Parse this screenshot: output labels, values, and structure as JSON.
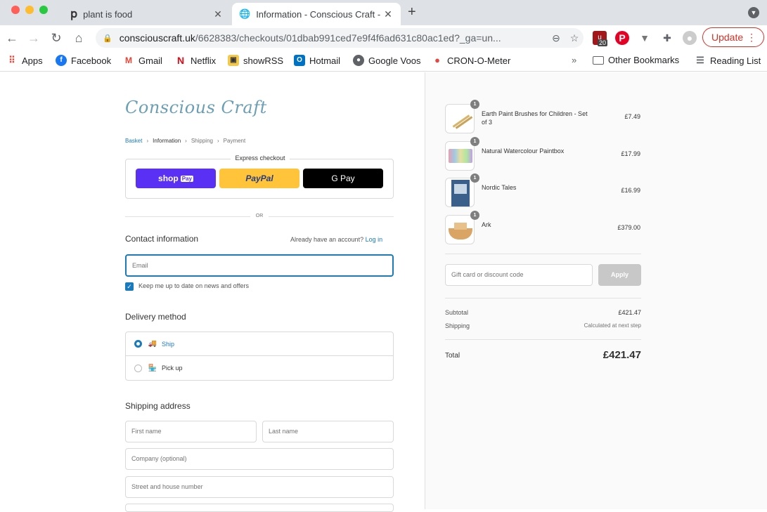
{
  "browser": {
    "tabs": [
      {
        "title": "plant is food",
        "icon": "pinterest-p-icon"
      },
      {
        "title": "Information - Conscious Craft -",
        "icon": "globe-icon"
      }
    ],
    "url_host": "consciouscraft.uk",
    "url_path": "/6628383/checkouts/01dbab991ced7e9f4f6ad631c80ac1ed?_ga=un...",
    "extension_badge": "20",
    "update_label": "Update",
    "bookmarks": [
      "Apps",
      "Facebook",
      "Gmail",
      "Netflix",
      "showRSS",
      "Hotmail",
      "Google Voos",
      "CRON-O-Meter"
    ],
    "more": "»",
    "other_bookmarks": "Other Bookmarks",
    "reading_list": "Reading List"
  },
  "checkout": {
    "logo": "Conscious Craft",
    "breadcrumb": [
      "Basket",
      "Information",
      "Shipping",
      "Payment"
    ],
    "express_title": "Express checkout",
    "shop_pay": "shop",
    "shop_pay_tag": "Pay",
    "paypal": "PayPal",
    "gpay": "G Pay",
    "or": "OR",
    "contact_title": "Contact information",
    "account_hint": "Already have an account?",
    "login_link": "Log in",
    "email_placeholder": "Email",
    "newsletter_label": "Keep me up to date on news and offers",
    "delivery_title": "Delivery method",
    "delivery_options": [
      {
        "label": "Ship",
        "selected": true
      },
      {
        "label": "Pick up",
        "selected": false
      }
    ],
    "shipping_title": "Shipping address",
    "first_name": "First name",
    "last_name": "Last name",
    "company": "Company (optional)",
    "street": "Street and house number"
  },
  "summary": {
    "items": [
      {
        "name": "Earth Paint Brushes for Children - Set of 3",
        "qty": "1",
        "price": "£7.49"
      },
      {
        "name": "Natural Watercolour Paintbox",
        "qty": "1",
        "price": "£17.99"
      },
      {
        "name": "Nordic Tales",
        "qty": "1",
        "price": "£16.99"
      },
      {
        "name": "Ark",
        "qty": "1",
        "price": "£379.00"
      }
    ],
    "discount_placeholder": "Gift card or discount code",
    "apply_label": "Apply",
    "subtotal_label": "Subtotal",
    "subtotal_value": "£421.47",
    "shipping_label": "Shipping",
    "shipping_value": "Calculated at next step",
    "total_label": "Total",
    "total_value": "£421.47"
  }
}
